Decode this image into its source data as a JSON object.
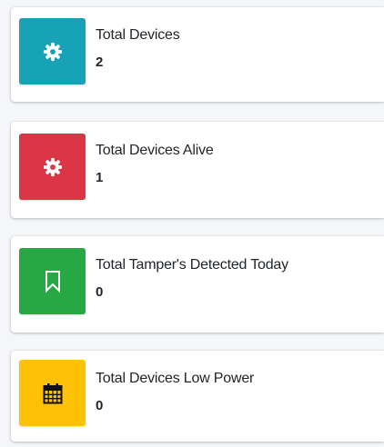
{
  "cards": [
    {
      "label": "Total Devices",
      "value": "2",
      "icon": "gear-icon",
      "color": "#17a2b8"
    },
    {
      "label": "Total Devices Alive",
      "value": "1",
      "icon": "gear-icon",
      "color": "#dc3545"
    },
    {
      "label": "Total Tamper's Detected Today",
      "value": "0",
      "icon": "bookmark-icon",
      "color": "#28a745"
    },
    {
      "label": "Total Devices Low Power",
      "value": "0",
      "icon": "calendar-icon",
      "color": "#ffc107"
    }
  ]
}
